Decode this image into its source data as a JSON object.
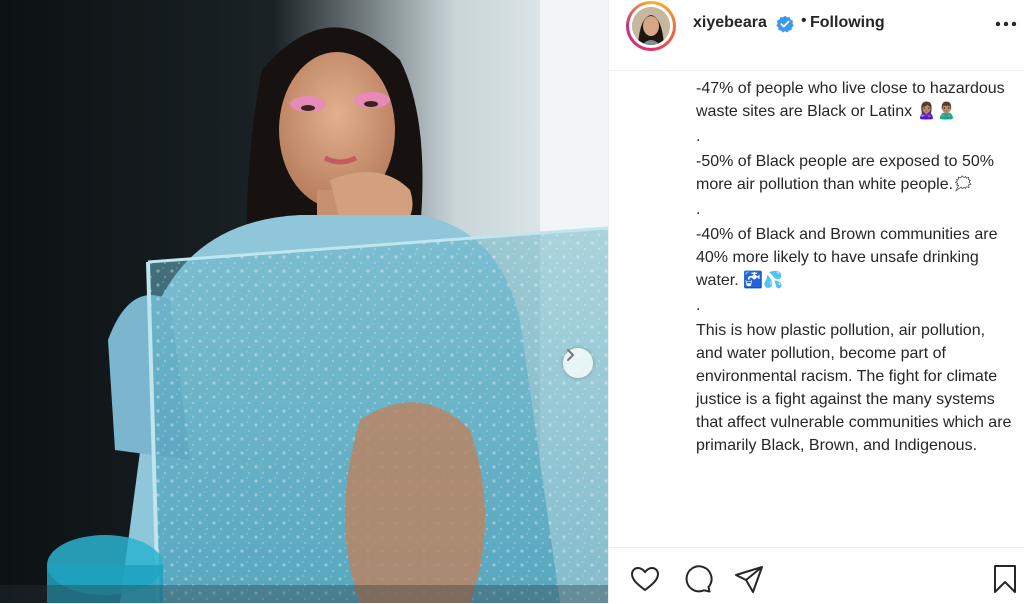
{
  "header": {
    "username": "xiyebeara",
    "separator": "•",
    "follow_status": "Following"
  },
  "caption": {
    "items": [
      "-47% of people who live close to hazardous waste sites are Black or Latinx 🙎🏽‍♀️🙎🏽‍♂️",
      ".",
      "-50% of Black people are exposed to 50% more air pollution than white people.🗯",
      ".",
      "-40% of Black and Brown communities are 40% more likely to have unsafe drinking water. 🚰💦",
      ".",
      "This is how plastic pollution, air pollution, and water pollution, become part of environmental racism. The fight for climate justice is a fight against the many systems that affect vulnerable communities which are primarily Black, Brown, and Indigenous."
    ]
  },
  "icons": {
    "verified": "verified-badge-icon",
    "more": "more-options-icon",
    "next": "chevron-right-icon",
    "like": "heart-icon",
    "comment": "comment-icon",
    "share": "paper-plane-icon",
    "save": "bookmark-icon"
  },
  "colors": {
    "verified_blue": "#3897f0",
    "text": "#262626",
    "divider": "#efefef"
  }
}
